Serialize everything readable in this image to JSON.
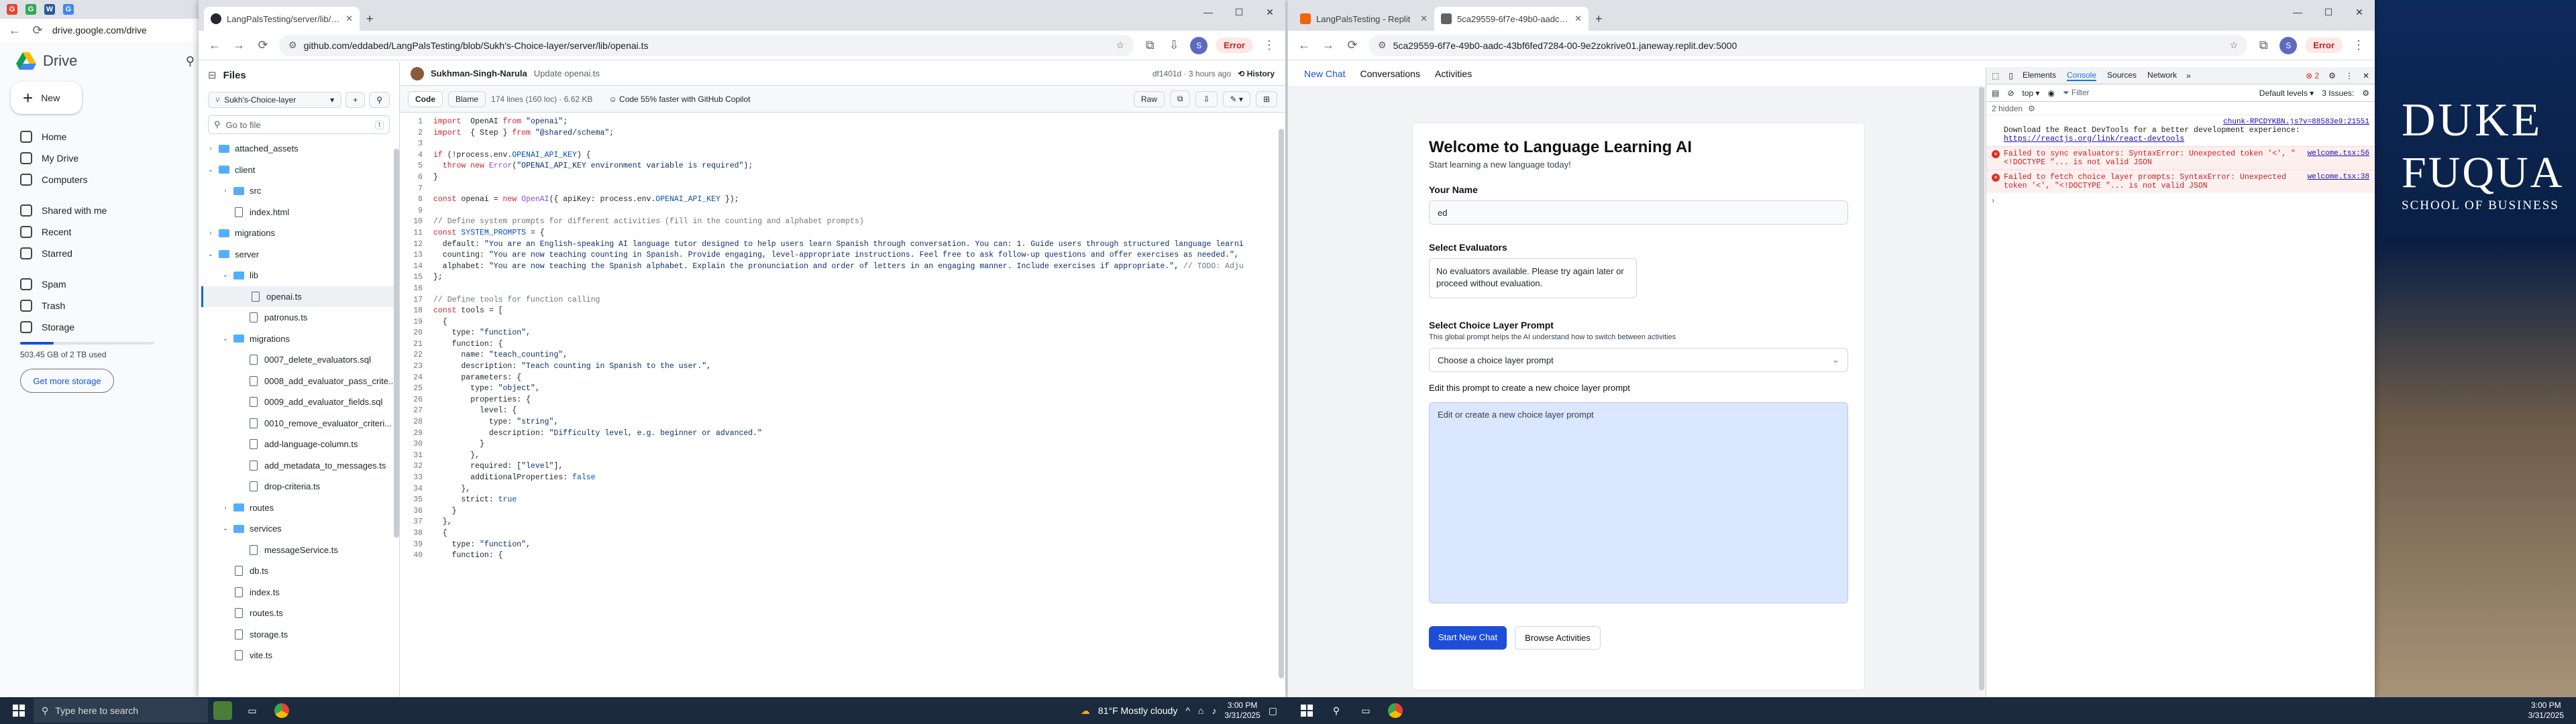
{
  "monitor1": {
    "back_tabs": [
      {
        "label": "G",
        "color": "#ea4335"
      },
      {
        "label": "G",
        "color": "#34a853"
      },
      {
        "label": "W",
        "color": "#2b579a"
      },
      {
        "label": "G",
        "color": "#4285f4"
      }
    ],
    "drive": {
      "url": "drive.google.com/drive",
      "brand": "Drive",
      "new_label": "New",
      "nav": [
        {
          "icon": "home-icon",
          "label": "Home"
        },
        {
          "icon": "my-drive-icon",
          "label": "My Drive"
        },
        {
          "icon": "computers-icon",
          "label": "Computers"
        },
        {
          "icon": "shared-icon",
          "label": "Shared with me"
        },
        {
          "icon": "recent-icon",
          "label": "Recent"
        },
        {
          "icon": "starred-icon",
          "label": "Starred"
        },
        {
          "icon": "spam-icon",
          "label": "Spam"
        },
        {
          "icon": "trash-icon",
          "label": "Trash"
        },
        {
          "icon": "storage-icon",
          "label": "Storage"
        }
      ],
      "storage_text": "503.45 GB of 2 TB used",
      "storage_fraction": 0.25,
      "get_storage": "Get more storage"
    },
    "github": {
      "tab_title": "LangPalsTesting/server/lib/op...",
      "url": "github.com/eddabed/LangPalsTesting/blob/Sukh's-Choice-layer/server/lib/openai.ts",
      "error_badge": "Error",
      "files_title": "Files",
      "branch": "Sukh's-Choice-layer",
      "go_to_file": "Go to file",
      "tree": [
        {
          "type": "folder",
          "depth": 0,
          "name": "attached_assets",
          "open": false
        },
        {
          "type": "folder",
          "depth": 0,
          "name": "client",
          "open": true
        },
        {
          "type": "folder",
          "depth": 1,
          "name": "src",
          "open": false
        },
        {
          "type": "file",
          "depth": 1,
          "name": "index.html"
        },
        {
          "type": "folder",
          "depth": 0,
          "name": "migrations",
          "open": false
        },
        {
          "type": "folder",
          "depth": 0,
          "name": "server",
          "open": true
        },
        {
          "type": "folder",
          "depth": 1,
          "name": "lib",
          "open": true
        },
        {
          "type": "file",
          "depth": 2,
          "name": "openai.ts",
          "selected": true
        },
        {
          "type": "file",
          "depth": 2,
          "name": "patronus.ts"
        },
        {
          "type": "folder",
          "depth": 1,
          "name": "migrations",
          "open": true
        },
        {
          "type": "file",
          "depth": 2,
          "name": "0007_delete_evaluators.sql"
        },
        {
          "type": "file",
          "depth": 2,
          "name": "0008_add_evaluator_pass_crite..."
        },
        {
          "type": "file",
          "depth": 2,
          "name": "0009_add_evaluator_fields.sql"
        },
        {
          "type": "file",
          "depth": 2,
          "name": "0010_remove_evaluator_criteri..."
        },
        {
          "type": "file",
          "depth": 2,
          "name": "add-language-column.ts"
        },
        {
          "type": "file",
          "depth": 2,
          "name": "add_metadata_to_messages.ts"
        },
        {
          "type": "file",
          "depth": 2,
          "name": "drop-criteria.ts"
        },
        {
          "type": "folder",
          "depth": 1,
          "name": "routes",
          "open": false
        },
        {
          "type": "folder",
          "depth": 1,
          "name": "services",
          "open": true
        },
        {
          "type": "file",
          "depth": 2,
          "name": "messageService.ts"
        },
        {
          "type": "file",
          "depth": 1,
          "name": "db.ts"
        },
        {
          "type": "file",
          "depth": 1,
          "name": "index.ts"
        },
        {
          "type": "file",
          "depth": 1,
          "name": "routes.ts"
        },
        {
          "type": "file",
          "depth": 1,
          "name": "storage.ts"
        },
        {
          "type": "file",
          "depth": 1,
          "name": "vite.ts"
        }
      ],
      "commit_author": "Sukhman-Singh-Narula",
      "commit_message": "Update openai.ts",
      "commit_meta": "df1401d · 3 hours ago",
      "history": "History",
      "code_tab": "Code",
      "blame_tab": "Blame",
      "file_info": "174 lines (160 loc) · 6.62 KB",
      "copilot": "Code 55% faster with GitHub Copilot",
      "raw": "Raw",
      "code": [
        [
          [
            "kw",
            "import"
          ],
          [
            "",
            "  OpenAI "
          ],
          [
            "kw",
            "from"
          ],
          [
            "str",
            " \"openai\""
          ],
          [
            "",
            ";"
          ]
        ],
        [
          [
            "kw",
            "import"
          ],
          [
            "",
            "  { Step } "
          ],
          [
            "kw",
            "from"
          ],
          [
            "str",
            " \"@shared/schema\""
          ],
          [
            "",
            ";"
          ]
        ],
        [
          [
            "",
            ""
          ]
        ],
        [
          [
            "kw",
            "if"
          ],
          [
            "",
            " (!process.env."
          ],
          [
            "pr",
            "OPENAI_API_KEY"
          ],
          [
            "",
            ") {"
          ]
        ],
        [
          [
            "",
            "  "
          ],
          [
            "kw",
            "throw new"
          ],
          [
            "fn",
            " Error"
          ],
          [
            "",
            "("
          ],
          [
            "str",
            "\"OPENAI_API_KEY environment variable is required\""
          ],
          [
            "",
            ");"
          ]
        ],
        [
          [
            "",
            "}"
          ]
        ],
        [
          [
            "",
            ""
          ]
        ],
        [
          [
            "kw",
            "const"
          ],
          [
            "",
            " openai = "
          ],
          [
            "kw",
            "new"
          ],
          [
            "fn",
            " OpenAI"
          ],
          [
            "",
            "({ apiKey: process.env."
          ],
          [
            "pr",
            "OPENAI_API_KEY"
          ],
          [
            "",
            " });"
          ]
        ],
        [
          [
            "",
            ""
          ]
        ],
        [
          [
            "cm",
            "// Define system prompts for different activities (fill in the counting and alphabet prompts)"
          ]
        ],
        [
          [
            "kw",
            "const"
          ],
          [
            "pr",
            " SYSTEM_PROMPTS"
          ],
          [
            "",
            " = {"
          ]
        ],
        [
          [
            "",
            "  default: "
          ],
          [
            "str",
            "\"You are an English-speaking AI language tutor designed to help users learn Spanish through conversation. You can: 1. Guide users through structured language learni"
          ]
        ],
        [
          [
            "",
            "  counting: "
          ],
          [
            "str",
            "\"You are now teaching counting in Spanish. Provide engaging, level-appropriate instructions. Feel free to ask follow-up questions and offer exercises as needed.\""
          ],
          [
            "",
            ","
          ]
        ],
        [
          [
            "",
            "  alphabet: "
          ],
          [
            "str",
            "\"You are now teaching the Spanish alphabet. Explain the pronunciation and order of letters in an engaging manner. Include exercises if appropriate.\""
          ],
          [
            "",
            ", "
          ],
          [
            "cm",
            "// TODO: Adju"
          ]
        ],
        [
          [
            "",
            "};"
          ]
        ],
        [
          [
            "",
            ""
          ]
        ],
        [
          [
            "cm",
            "// Define tools for function calling"
          ]
        ],
        [
          [
            "kw",
            "const"
          ],
          [
            "",
            " tools = ["
          ]
        ],
        [
          [
            "",
            "  {"
          ]
        ],
        [
          [
            "",
            "    type: "
          ],
          [
            "str",
            "\"function\""
          ],
          [
            "",
            ","
          ]
        ],
        [
          [
            "",
            "    function: {"
          ]
        ],
        [
          [
            "",
            "      name: "
          ],
          [
            "str",
            "\"teach_counting\""
          ],
          [
            "",
            ","
          ]
        ],
        [
          [
            "",
            "      description: "
          ],
          [
            "str",
            "\"Teach counting in Spanish to the user.\""
          ],
          [
            "",
            ","
          ]
        ],
        [
          [
            "",
            "      parameters: {"
          ]
        ],
        [
          [
            "",
            "        type: "
          ],
          [
            "str",
            "\"object\""
          ],
          [
            "",
            ","
          ]
        ],
        [
          [
            "",
            "        properties: {"
          ]
        ],
        [
          [
            "",
            "          level: {"
          ]
        ],
        [
          [
            "",
            "            type: "
          ],
          [
            "str",
            "\"string\""
          ],
          [
            "",
            ","
          ]
        ],
        [
          [
            "",
            "            description: "
          ],
          [
            "str",
            "\"Difficulty level, e.g. beginner or advanced.\""
          ]
        ],
        [
          [
            "",
            "          }"
          ]
        ],
        [
          [
            "",
            "        },"
          ]
        ],
        [
          [
            "",
            "        required: ["
          ],
          [
            "str",
            "\"level\""
          ],
          [
            "",
            "],"
          ]
        ],
        [
          [
            "",
            "        additionalProperties: "
          ],
          [
            "pr",
            "false"
          ]
        ],
        [
          [
            "",
            "      },"
          ]
        ],
        [
          [
            "",
            "      strict: "
          ],
          [
            "pr",
            "true"
          ]
        ],
        [
          [
            "",
            "    }"
          ]
        ],
        [
          [
            "",
            "  },"
          ]
        ],
        [
          [
            "",
            "  {"
          ]
        ],
        [
          [
            "",
            "    type: "
          ],
          [
            "str",
            "\"function\""
          ],
          [
            "",
            ","
          ]
        ],
        [
          [
            "",
            "    function: {"
          ]
        ]
      ]
    },
    "taskbar": {
      "search_placeholder": "Type here to search",
      "weather": "81°F  Mostly cloudy",
      "time": "3:00 PM",
      "date": "3/31/2025"
    }
  },
  "monitor2": {
    "tabs": [
      {
        "label": "LangPalsTesting - Replit",
        "active": false
      },
      {
        "label": "5ca29559-6f7e-49b0-aadc-43b",
        "active": true
      }
    ],
    "url": "5ca29559-6f7e-49b0-aadc-43bf6fed7284-00-9e2zokrive01.janeway.replit.dev:5000",
    "error_badge": "Error",
    "app_nav": [
      "New Chat",
      "Conversations",
      "Activities"
    ],
    "app": {
      "title": "Welcome to Language Learning AI",
      "subtitle": "Start learning a new language today!",
      "name_label": "Your Name",
      "name_value": "ed",
      "evaluators_label": "Select Evaluators",
      "evaluators_text": "No evaluators available. Please try again later or proceed without evaluation.",
      "choice_label": "Select Choice Layer Prompt",
      "choice_help": "This global prompt helps the AI understand how to switch between activities",
      "choice_select": "Choose a choice layer prompt",
      "edit_label": "Edit this prompt to create a new choice layer prompt",
      "edit_placeholder": "Edit or create a new choice layer prompt",
      "start_button": "Start New Chat",
      "browse_button": "Browse Activities"
    },
    "devtools": {
      "tabs": [
        "Elements",
        "Console",
        "Sources",
        "Network"
      ],
      "context": "top",
      "filter": "Filter",
      "levels": "Default levels",
      "issues": "3 Issues:",
      "error_count": "2",
      "hidden": "2 hidden",
      "info_link": "chunk-RPCDYKBN.js?v=88583e9:21551",
      "info_text": "Download the React DevTools for a better development experience:",
      "info_url": "https://reactjs.org/link/react-devtools",
      "errors": [
        {
          "text": "Failed to sync evaluators: SyntaxError: Unexpected token '<', \"<!DOCTYPE \"... is not valid JSON",
          "source": "welcome.tsx:56"
        },
        {
          "text": "Failed to fetch choice layer prompts: SyntaxError: Unexpected token '<', \"<!DOCTYPE \"... is not valid JSON",
          "source": "welcome.tsx:38"
        }
      ]
    },
    "wallpaper_text": [
      "DUKE",
      "FUQUA",
      "SCHOOL OF BUSINESS"
    ],
    "taskbar": {
      "time": "3:00 PM",
      "date": "3/31/2025"
    }
  }
}
